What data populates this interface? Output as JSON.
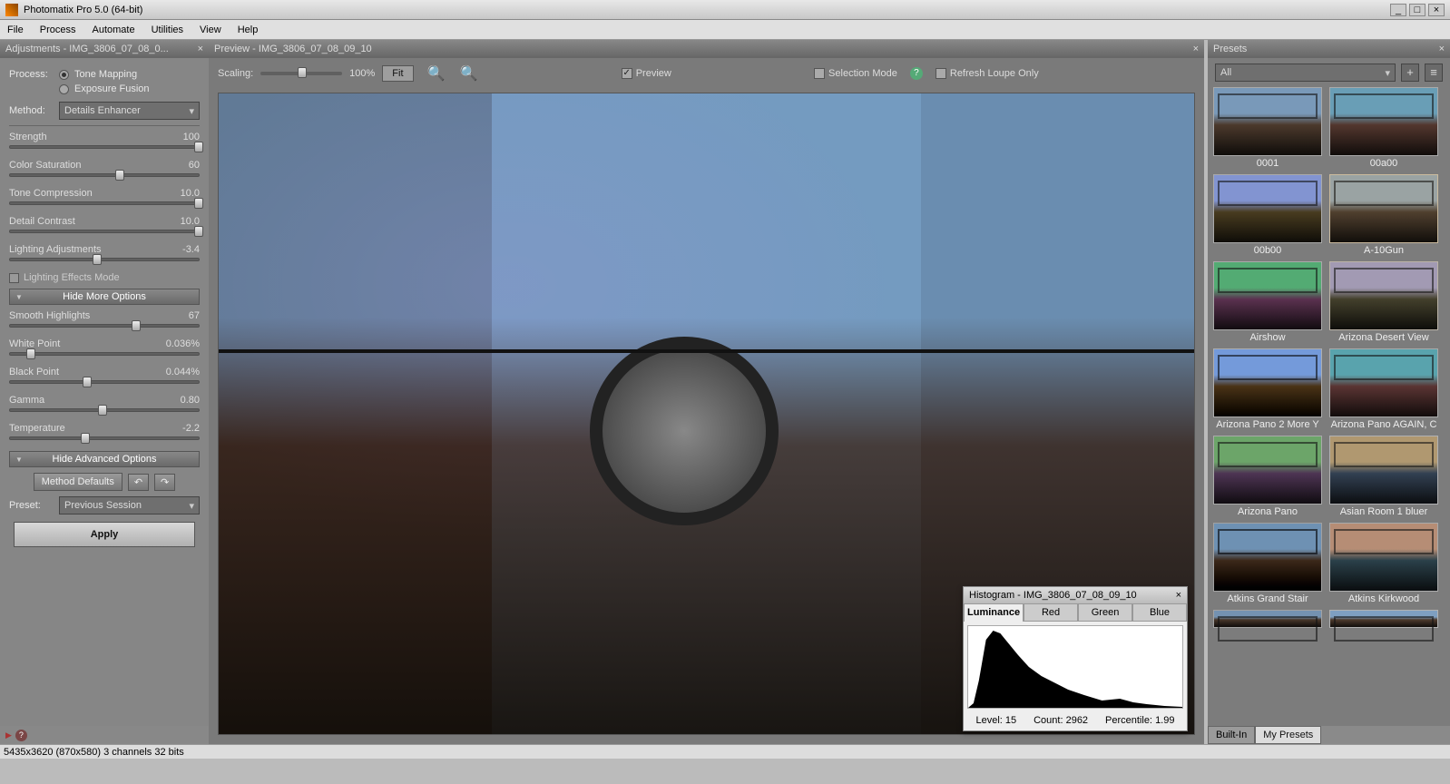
{
  "window": {
    "title": "Photomatix Pro 5.0 (64-bit)"
  },
  "menu": [
    "File",
    "Process",
    "Automate",
    "Utilities",
    "View",
    "Help"
  ],
  "adjustments": {
    "title": "Adjustments - IMG_3806_07_08_0...",
    "process_label": "Process:",
    "process_opt1": "Tone Mapping",
    "process_opt2": "Exposure Fusion",
    "method_label": "Method:",
    "method_value": "Details Enhancer",
    "sliders1": [
      {
        "label": "Strength",
        "value": "100",
        "pct": 100
      },
      {
        "label": "Color Saturation",
        "value": "60",
        "pct": 58
      },
      {
        "label": "Tone Compression",
        "value": "10.0",
        "pct": 100
      },
      {
        "label": "Detail Contrast",
        "value": "10.0",
        "pct": 100
      },
      {
        "label": "Lighting Adjustments",
        "value": "-3.4",
        "pct": 46
      }
    ],
    "lighting_effects": "Lighting Effects Mode",
    "hide_more": "Hide More Options",
    "sliders2": [
      {
        "label": "Smooth Highlights",
        "value": "67",
        "pct": 67
      },
      {
        "label": "White Point",
        "value": "0.036%",
        "pct": 11
      },
      {
        "label": "Black Point",
        "value": "0.044%",
        "pct": 41
      },
      {
        "label": "Gamma",
        "value": "0.80",
        "pct": 49
      },
      {
        "label": "Temperature",
        "value": "-2.2",
        "pct": 40
      }
    ],
    "hide_adv": "Hide Advanced Options",
    "method_defaults": "Method Defaults",
    "preset_label": "Preset:",
    "preset_value": "Previous Session",
    "apply": "Apply"
  },
  "preview": {
    "title": "Preview - IMG_3806_07_08_09_10",
    "scaling_label": "Scaling:",
    "scaling_value": "100%",
    "fit": "Fit",
    "preview_chk": "Preview",
    "selection_mode": "Selection Mode",
    "refresh_loupe": "Refresh Loupe Only"
  },
  "histogram": {
    "title": "Histogram - IMG_3806_07_08_09_10",
    "tabs": [
      "Luminance",
      "Red",
      "Green",
      "Blue"
    ],
    "level_label": "Level:",
    "level": "15",
    "count_label": "Count:",
    "count": "2962",
    "pct_label": "Percentile:",
    "pct": "1.99"
  },
  "presets": {
    "title": "Presets",
    "filter": "All",
    "items": [
      "0001",
      "00a00",
      "00b00",
      "A-10Gun",
      "Airshow",
      "Arizona Desert View",
      "Arizona Pano 2 More Y",
      "Arizona Pano AGAIN, C",
      "Arizona Pano",
      "Asian Room 1 bluer",
      "Atkins Grand Stair",
      "Atkins Kirkwood"
    ],
    "tab_builtin": "Built-In",
    "tab_mine": "My Presets"
  },
  "status": "5435x3620 (870x580) 3 channels 32 bits"
}
